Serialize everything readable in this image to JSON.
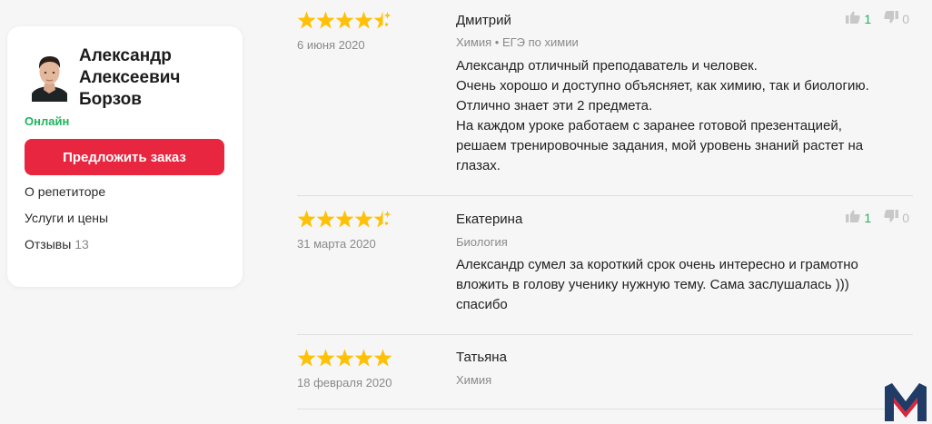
{
  "tutor": {
    "name_line1": "Александр",
    "name_line2": "Алексеевич",
    "name_line3": "Борзов",
    "status": "Онлайн",
    "offer_button": "Предложить заказ",
    "menu": {
      "about": "О репетиторе",
      "services": "Услуги и цены",
      "reviews": "Отзывы",
      "reviews_count": "13"
    }
  },
  "reviews": [
    {
      "rating": 4.5,
      "date": "6 июня 2020",
      "author": "Дмитрий",
      "subject": "Химия • ЕГЭ по химии",
      "text_lines": [
        "Александр отличный преподаватель и человек.",
        "Очень хорошо и доступно объясняет, как химию, так и биологию.",
        "Отлично знает эти 2 предмета.",
        "На каждом уроке работаем с заранее готовой презентацией,",
        "решаем тренировочные задания, мой уровень знаний растет на",
        "глазах."
      ],
      "likes": "1",
      "dislikes": "0"
    },
    {
      "rating": 4.5,
      "date": "31 марта 2020",
      "author": "Екатерина",
      "subject": "Биология",
      "text_lines": [
        "Александр сумел за короткий срок очень интересно и грамотно",
        "вложить в голову ученику нужную тему. Сама заслушалась )))",
        "спасибо"
      ],
      "likes": "1",
      "dislikes": "0"
    },
    {
      "rating": 5,
      "date": "18 февраля 2020",
      "author": "Татьяна",
      "subject": "Химия"
    }
  ],
  "colors": {
    "accent": "#e8263f",
    "online": "#1fb45c",
    "star": "#ffc107",
    "logo_blue": "#1f3b66",
    "logo_red": "#d9263a"
  },
  "icons": {
    "like": "thumbs-up-icon",
    "dislike": "thumbs-down-icon",
    "star": "star-icon",
    "logo": "m-logo-icon"
  }
}
